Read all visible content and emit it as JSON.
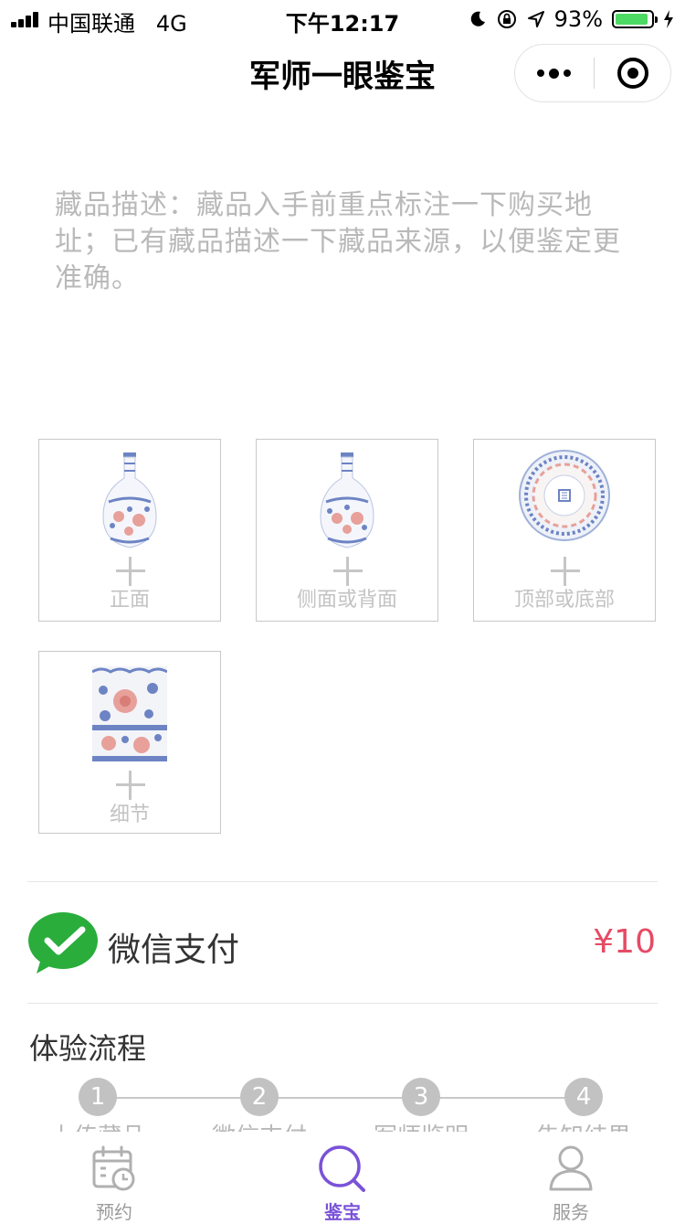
{
  "status_bar": {
    "carrier": "中国联通",
    "network": "4G",
    "time": "下午12:17",
    "battery_percent": "93%",
    "battery_level": 0.93
  },
  "nav": {
    "title": "军师一眼鉴宝"
  },
  "description": {
    "placeholder": "藏品描述：藏品入手前重点标注一下购买地址；已有藏品描述一下藏品来源，以便鉴定更准确。"
  },
  "uploads": [
    {
      "label": "正面",
      "image": "vase"
    },
    {
      "label": "侧面或背面",
      "image": "vase"
    },
    {
      "label": "顶部或底部",
      "image": "plate"
    },
    {
      "label": "细节",
      "image": "detail"
    }
  ],
  "payment": {
    "method": "微信支付",
    "price": "¥10",
    "icon": "wechat-pay-icon",
    "brand_color": "#2aad3b",
    "price_color": "#e64a64"
  },
  "flow": {
    "title": "体验流程",
    "steps": [
      {
        "num": "1",
        "label": "上传藏品"
      },
      {
        "num": "2",
        "label": "微信支付"
      },
      {
        "num": "3",
        "label": "军师鉴明"
      },
      {
        "num": "4",
        "label": "告知结果"
      }
    ]
  },
  "tabbar": {
    "accent": "#7a52d8",
    "items": [
      {
        "label": "预约",
        "icon": "calendar-icon",
        "active": false
      },
      {
        "label": "鉴宝",
        "icon": "search-icon",
        "active": true
      },
      {
        "label": "服务",
        "icon": "person-icon",
        "active": false
      }
    ]
  }
}
